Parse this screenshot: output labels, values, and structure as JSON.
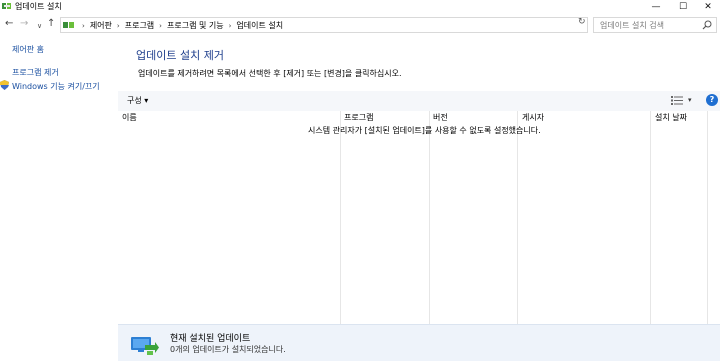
{
  "window": {
    "title": "업데이트 설치",
    "minimize": "—",
    "maximize": "☐",
    "close": "✕"
  },
  "nav": {
    "back": "←",
    "forward": "→",
    "recent": "∨",
    "up": "↑",
    "breadcrumb": [
      "제어판",
      "프로그램",
      "프로그램 및 기능",
      "업데이트 설치"
    ],
    "separator": "›",
    "dropdown": "∨",
    "refresh": "↻",
    "search_placeholder": "업데이트 설치 검색"
  },
  "sidebar": {
    "home": "제어판 홈",
    "remove_program": "프로그램 제거",
    "windows_features": "Windows 기능 켜기/끄기"
  },
  "main": {
    "heading": "업데이트 설치 제거",
    "description": "업데이트를 제거하려면 목록에서 선택한 후 [제거] 또는 [변경]을 클릭하십시오."
  },
  "toolbar": {
    "organize": "구성 ▾",
    "view_dropdown": "▾",
    "help": "?"
  },
  "list": {
    "columns": [
      "이름",
      "프로그램",
      "버전",
      "게시자",
      "설치 날짜"
    ],
    "empty_message": "시스템 관리자가 [설치된 업데이트]를 사용할 수 없도록 설정했습니다."
  },
  "details": {
    "title": "현재 설치된 업데이트",
    "subtitle": "0개의 업데이트가 설치되었습니다."
  },
  "colors": {
    "link": "#1a4fa0",
    "heading": "#1e3e8c",
    "toolbar_bg": "#f5f7fa",
    "details_bg": "#eef3fa",
    "help_blue": "#1f6fd1"
  }
}
